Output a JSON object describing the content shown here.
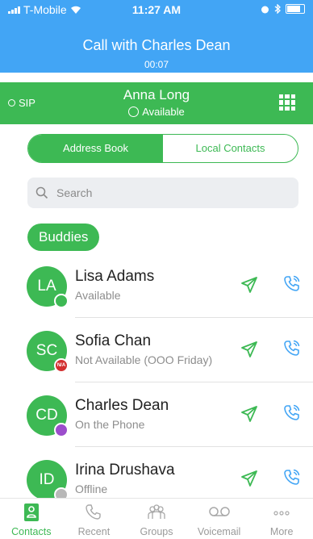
{
  "status_bar": {
    "carrier": "T-Mobile",
    "time": "11:27 AM"
  },
  "call_banner": {
    "title": "Call with Charles Dean",
    "duration": "00:07"
  },
  "account": {
    "protocol": "SIP",
    "name": "Anna Long",
    "status": "Available"
  },
  "segments": {
    "address_book": "Address Book",
    "local_contacts": "Local Contacts",
    "active": "address_book"
  },
  "search": {
    "placeholder": "Search",
    "value": ""
  },
  "section": {
    "label": "Buddies"
  },
  "contacts": [
    {
      "initials": "LA",
      "name": "Lisa Adams",
      "status": "Available",
      "presence": "available"
    },
    {
      "initials": "SC",
      "name": "Sofia Chan",
      "status": "Not Available (OOO Friday)",
      "presence": "not-available",
      "presence_text": "N/A"
    },
    {
      "initials": "CD",
      "name": "Charles Dean",
      "status": "On the Phone",
      "presence": "on-the-phone"
    },
    {
      "initials": "ID",
      "name": "Irina Drushava",
      "status": "Offline",
      "presence": "offline"
    }
  ],
  "tabs": [
    {
      "label": "Contacts",
      "icon": "contacts-icon",
      "active": true
    },
    {
      "label": "Recent",
      "icon": "phone-icon",
      "active": false
    },
    {
      "label": "Groups",
      "icon": "groups-icon",
      "active": false
    },
    {
      "label": "Voicemail",
      "icon": "voicemail-icon",
      "active": false
    },
    {
      "label": "More",
      "icon": "more-icon",
      "active": false
    }
  ],
  "colors": {
    "header_blue": "#42a5f5",
    "brand_green": "#3db954",
    "available": "#3db954",
    "not_available": "#d32f2f",
    "on_the_phone": "#9c4dcc",
    "offline": "#b8b8b8"
  }
}
